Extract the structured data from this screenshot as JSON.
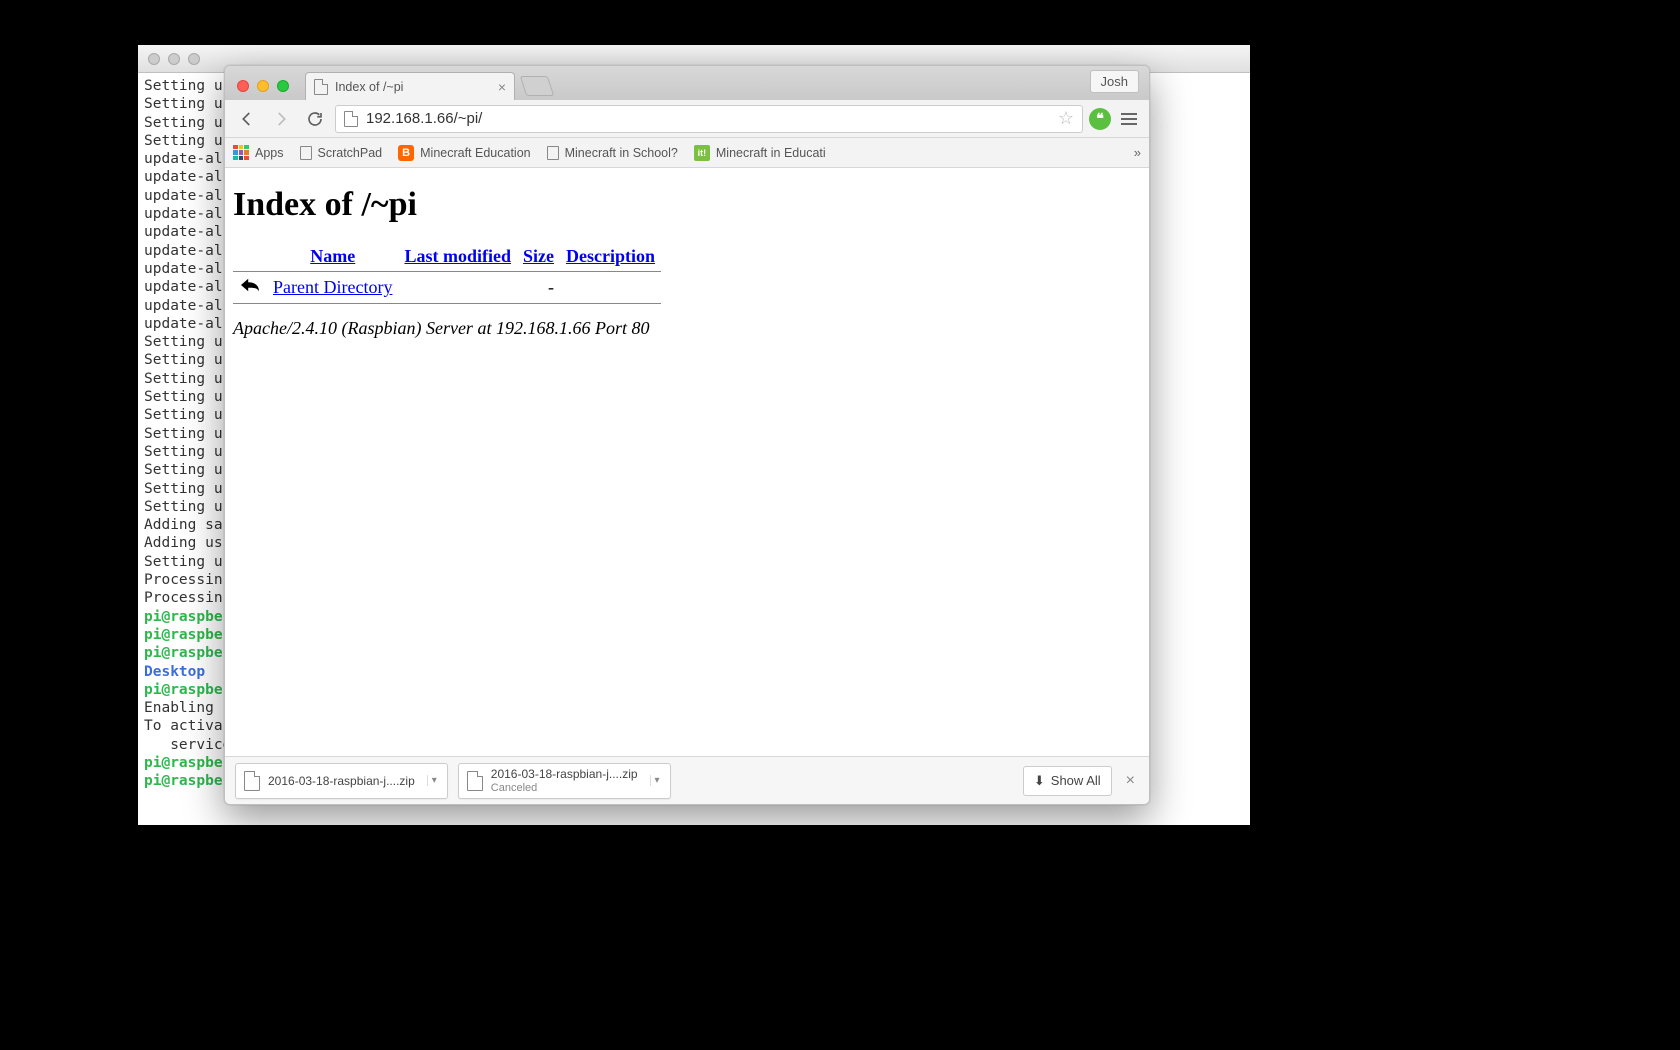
{
  "background_window": {
    "terminal_lines": [
      {
        "t": "Setting u"
      },
      {
        "t": "Setting u"
      },
      {
        "t": "Setting u"
      },
      {
        "t": "Setting u"
      },
      {
        "t": "update-al"
      },
      {
        "t": "update-al"
      },
      {
        "t": "update-al"
      },
      {
        "t": "update-al"
      },
      {
        "t": "update-al"
      },
      {
        "t": "update-al"
      },
      {
        "t": "update-al"
      },
      {
        "t": "update-al"
      },
      {
        "t": "update-al"
      },
      {
        "t": "update-al"
      },
      {
        "t": "Setting u"
      },
      {
        "t": "Setting u"
      },
      {
        "t": "Setting u"
      },
      {
        "t": "Setting u"
      },
      {
        "t": "Setting u"
      },
      {
        "t": "Setting u"
      },
      {
        "t": "Setting u"
      },
      {
        "t": "Setting u"
      },
      {
        "t": "Setting u"
      },
      {
        "t": "Setting u"
      },
      {
        "t": "Adding sa"
      },
      {
        "t": "Adding us"
      },
      {
        "t": "Setting u"
      },
      {
        "t": "Processin"
      },
      {
        "t": "Processin"
      },
      {
        "p": "pi@raspbe"
      },
      {
        "p": "pi@raspbe"
      },
      {
        "p": "pi@raspbe"
      },
      {
        "c": "Desktop"
      },
      {
        "p": "pi@raspbe"
      },
      {
        "t": "Enabling "
      },
      {
        "t": "To activa"
      },
      {
        "t": "   service"
      },
      {
        "p": "pi@raspbe"
      },
      {
        "pf": "pi@raspberrypi",
        "co": ":",
        "pc": "~",
        "ds": " $ "
      }
    ]
  },
  "chrome": {
    "profile": "Josh",
    "tab_title": "Index of /~pi",
    "url": "192.168.1.66/~pi/",
    "bookmarks": [
      {
        "label": "Apps",
        "type": "apps"
      },
      {
        "label": "ScratchPad",
        "type": "page"
      },
      {
        "label": "Minecraft Education",
        "type": "blogger"
      },
      {
        "label": "Minecraft in School?",
        "type": "page"
      },
      {
        "label": "Minecraft in Educati",
        "type": "it"
      }
    ],
    "bookmarks_overflow": "»"
  },
  "page": {
    "heading": "Index of /~pi",
    "columns": {
      "name": "Name",
      "modified": "Last modified",
      "size": "Size",
      "desc": "Description"
    },
    "parent_label": "Parent Directory",
    "parent_size": "-",
    "server_sig": "Apache/2.4.10 (Raspbian) Server at 192.168.1.66 Port 80"
  },
  "downloads": {
    "items": [
      {
        "name": "2016-03-18-raspbian-j....zip",
        "sub": ""
      },
      {
        "name": "2016-03-18-raspbian-j....zip",
        "sub": "Canceled"
      }
    ],
    "show_all": "Show All"
  }
}
